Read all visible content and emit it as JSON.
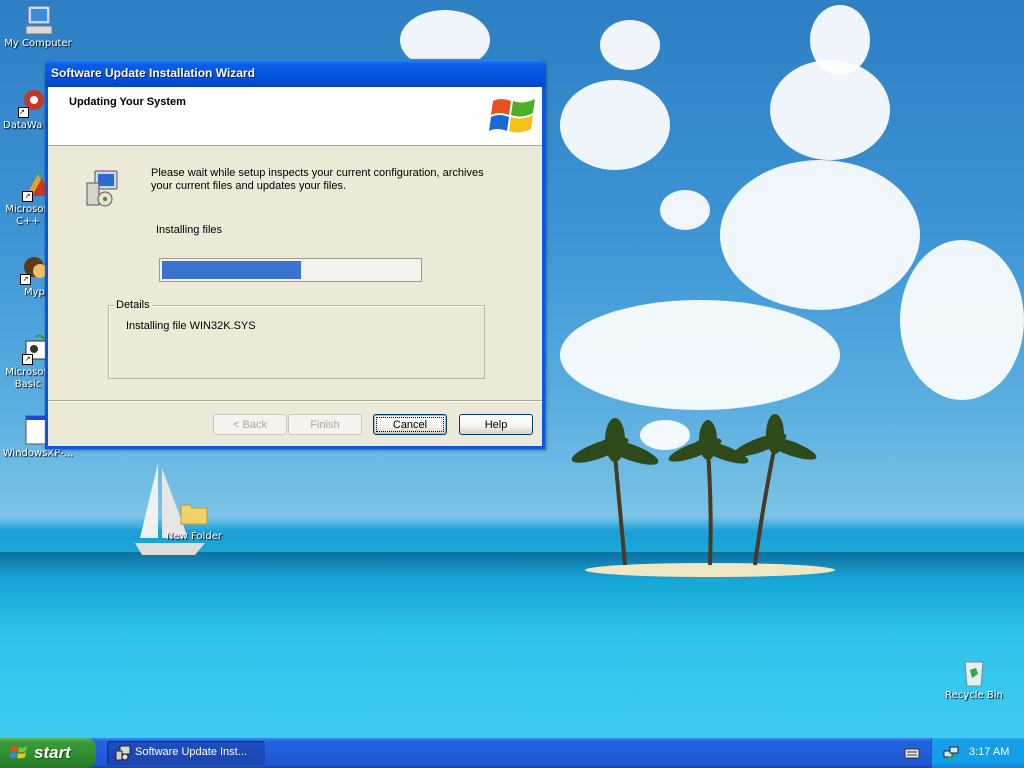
{
  "desktop": {
    "icons": [
      {
        "label": "My Computer",
        "icon": "my-computer-icon"
      },
      {
        "label": "DataWa",
        "icon": "datawave-icon"
      },
      {
        "label": "Microsoft\nC++",
        "icon": "microsoft-cpp-icon"
      },
      {
        "label": "Myp",
        "icon": "myp-icon"
      },
      {
        "label": "Microsoft\nBasic",
        "icon": "microsoft-basic-icon"
      },
      {
        "label": "WindowsXP-...",
        "icon": "windows-xp-file-icon"
      },
      {
        "label": "New Folder",
        "icon": "folder-icon"
      },
      {
        "label": "Recycle Bin",
        "icon": "recycle-bin-icon"
      }
    ]
  },
  "wizard": {
    "title": "Software Update Installation Wizard",
    "header_title": "Updating Your System",
    "intro_text": "Please wait while setup inspects your current configuration, archives your current files and updates your files.",
    "status_label": "Installing files",
    "progress_fraction": 0.54,
    "details_label": "Details",
    "details_text": "Installing file WIN32K.SYS",
    "buttons": {
      "back": "< Back",
      "finish": "Finish",
      "cancel": "Cancel",
      "help": "Help"
    }
  },
  "taskbar": {
    "start_label": "start",
    "task_item_label": "Software Update Inst...",
    "clock": "3:17 AM"
  },
  "colors": {
    "title_bar": "#0553de",
    "progress_fill": "#3a74d0",
    "start_button": "#3c9a3c"
  }
}
